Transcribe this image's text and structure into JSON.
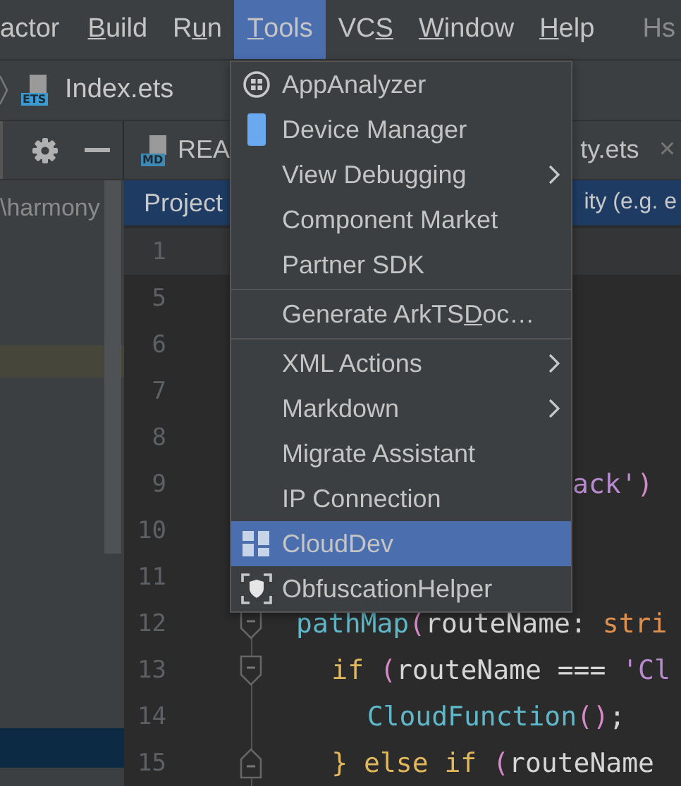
{
  "menubar": {
    "items": [
      {
        "pre": "actor",
        "selected": false
      },
      {
        "key": "B",
        "post": "uild",
        "selected": false
      },
      {
        "pre": "R",
        "key": "u",
        "post": "n",
        "selected": false
      },
      {
        "key": "T",
        "post": "ools",
        "selected": true
      },
      {
        "pre": "VC",
        "key": "S",
        "selected": false
      },
      {
        "key": "W",
        "post": "indow",
        "selected": false
      },
      {
        "key": "H",
        "post": "elp",
        "selected": false
      }
    ],
    "trailing": "Hs"
  },
  "breadcrumb": {
    "icon_label": "ETS",
    "file": "Index.ets"
  },
  "editor_tabs": [
    {
      "icon_label": "MD",
      "label": "REA"
    },
    {
      "label": "ty.ets",
      "close": "×"
    }
  ],
  "project_panel": {
    "path": "\\harmony",
    "rows": [
      {
        "kind": "highlight"
      },
      {
        "kind": "selection"
      }
    ]
  },
  "banner": {
    "title": "Project",
    "hint": "ity (e.g. e"
  },
  "editor": {
    "lines": [
      {
        "number": "1",
        "current": true,
        "kind": "plain"
      },
      {
        "number": "5",
        "current": false,
        "kind": "plain"
      },
      {
        "number": "6",
        "current": false,
        "kind": "plain"
      },
      {
        "number": "7",
        "current": false,
        "kind": "plain"
      },
      {
        "number": "8",
        "current": false,
        "kind": "plain"
      },
      {
        "number": "9",
        "current": false,
        "kind": "clipped",
        "tokens": [
          {
            "kind": "string",
            "text": "ack'"
          },
          {
            "kind": "paren",
            "text": ")"
          }
        ]
      },
      {
        "number": "10",
        "current": false,
        "kind": "plain"
      },
      {
        "number": "11",
        "current": false,
        "kind": "plain"
      },
      {
        "number": "12",
        "current": false,
        "kind": "foldstart",
        "tokens": [
          {
            "kind": "fn",
            "text": "pathMap"
          },
          {
            "kind": "paren",
            "text": "("
          },
          {
            "kind": "ident",
            "text": "routeName: "
          },
          {
            "kind": "type",
            "text": "stri"
          }
        ],
        "children": [
          {
            "number": "13",
            "current": false,
            "kind": "foldstart",
            "tokens": [
              {
                "kind": "keyword",
                "text": "if "
              },
              {
                "kind": "paren",
                "text": "("
              },
              {
                "kind": "ident",
                "text": "routeName === "
              },
              {
                "kind": "string",
                "text": "'Cl"
              }
            ],
            "children": [
              {
                "number": "14",
                "current": false,
                "kind": "plain",
                "tokens": [
                  {
                    "kind": "fn",
                    "text": "CloudFunction"
                  },
                  {
                    "kind": "paren",
                    "text": "()"
                  },
                  {
                    "kind": "ident",
                    "text": ";"
                  }
                ]
              }
            ]
          },
          {
            "number": "15",
            "current": false,
            "kind": "foldend",
            "tokens": [
              {
                "kind": "keyword",
                "text": "} else if "
              },
              {
                "kind": "paren",
                "text": "("
              },
              {
                "kind": "ident",
                "text": "routeName"
              }
            ]
          }
        ]
      }
    ]
  },
  "tools_menu": {
    "items": [
      {
        "kind": "analyzer",
        "label": "AppAnalyzer",
        "submenu": false,
        "selected": false
      },
      {
        "kind": "device",
        "label": "Device Manager",
        "submenu": false,
        "selected": false
      },
      {
        "kind": "item",
        "label": "View Debugging",
        "submenu": true,
        "selected": false
      },
      {
        "kind": "item",
        "label": "Component Market",
        "submenu": false,
        "selected": false
      },
      {
        "kind": "item",
        "label": "Partner SDK",
        "submenu": false,
        "selected": false
      },
      {
        "kind": "separator"
      },
      {
        "kind": "item",
        "pre": "Generate ArkTS",
        "key": "D",
        "post": "oc…",
        "submenu": false,
        "selected": false
      },
      {
        "kind": "separator"
      },
      {
        "kind": "item",
        "label": "XML Actions",
        "submenu": true,
        "selected": false
      },
      {
        "kind": "item",
        "label": "Markdown",
        "submenu": true,
        "selected": false
      },
      {
        "kind": "item",
        "label": "Migrate Assistant",
        "submenu": false,
        "selected": false
      },
      {
        "kind": "item",
        "label": "IP Connection",
        "submenu": false,
        "selected": false
      },
      {
        "kind": "cloud",
        "label": "CloudDev",
        "submenu": false,
        "selected": true
      },
      {
        "kind": "shield",
        "label": "ObfuscationHelper",
        "submenu": false,
        "selected": false
      }
    ]
  }
}
